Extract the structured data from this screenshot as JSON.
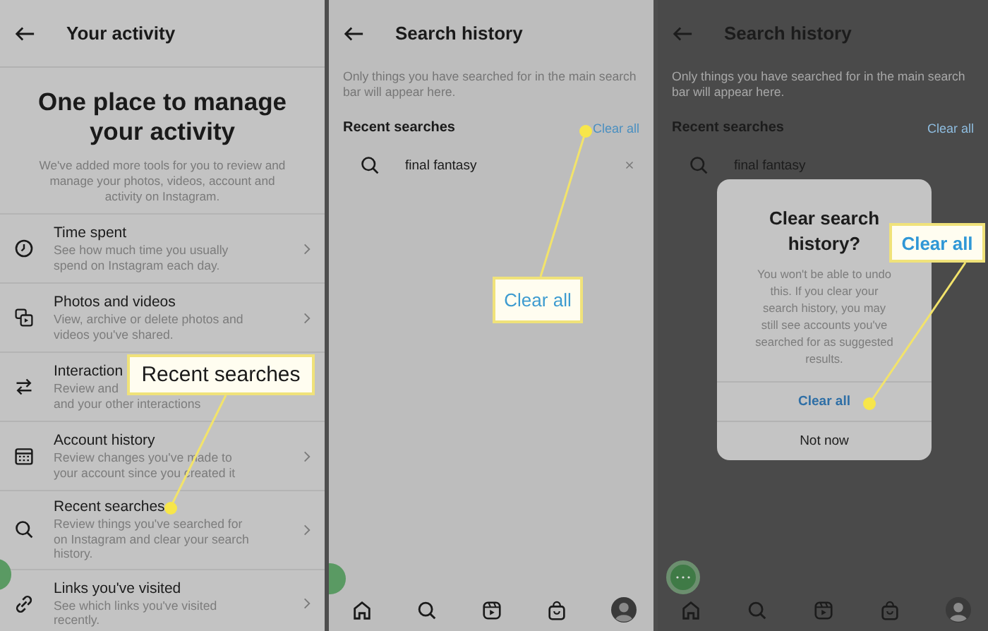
{
  "activity_screen": {
    "title": "Your activity",
    "heading": "One place to manage your activity",
    "intro": "We've added more tools for you to review and manage your photos, videos, account and activity on Instagram.",
    "items": [
      {
        "kind": "clock",
        "title": "Time spent",
        "lines": [
          "See how much time you usually",
          "spend on Instagram each day."
        ]
      },
      {
        "kind": "media",
        "title": "Photos and videos",
        "lines": [
          "View, archive or delete photos and",
          "videos you've shared."
        ]
      },
      {
        "kind": "arrows",
        "title": "Interaction",
        "lines": [
          "Review and",
          "and your other interactions"
        ]
      },
      {
        "kind": "calendar",
        "title": "Account history",
        "lines": [
          "Review changes you've made to",
          "your account since you created it"
        ]
      },
      {
        "kind": "search",
        "title": "Recent searches",
        "lines": [
          "Review things you've searched for",
          "on Instagram and clear your search",
          "history."
        ]
      },
      {
        "kind": "link",
        "title": "Links you've visited",
        "lines": [
          "See which links you've visited",
          "recently."
        ]
      }
    ],
    "callout": "Recent searches"
  },
  "search_screen": {
    "title": "Search history",
    "description": "Only things you have searched for in the main search bar will appear here.",
    "section": "Recent searches",
    "clear_link": "Clear all",
    "results": [
      "final fantasy"
    ],
    "callout": "Clear all"
  },
  "dialog_screen": {
    "title": "Search history",
    "description": "Only things you have searched for in the main search bar will appear here.",
    "section": "Recent searches",
    "clear_link": "Clear all",
    "results": [
      "final fantasy"
    ],
    "dialog": {
      "title": "Clear search history?",
      "body": "You won't be able to undo this. If you clear your search history, you may still see accounts you've searched for as suggested results.",
      "confirm": "Clear all",
      "cancel": "Not now"
    },
    "callout": "Clear all"
  }
}
